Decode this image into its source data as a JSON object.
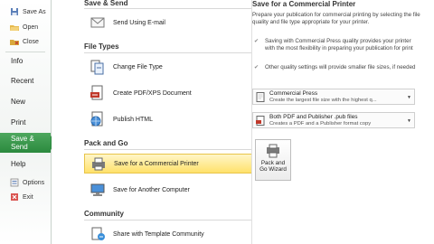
{
  "sidebar": {
    "small_top": [
      {
        "label": "Save As",
        "icon": "save-as-icon"
      },
      {
        "label": "Open",
        "icon": "open-folder-icon"
      },
      {
        "label": "Close",
        "icon": "close-folder-icon"
      }
    ],
    "main": [
      {
        "label": "Info"
      },
      {
        "label": "Recent"
      },
      {
        "label": "New"
      },
      {
        "label": "Print"
      },
      {
        "label": "Save & Send",
        "active": true
      },
      {
        "label": "Help"
      }
    ],
    "small_bottom": [
      {
        "label": "Options",
        "icon": "options-icon"
      },
      {
        "label": "Exit",
        "icon": "exit-icon"
      }
    ]
  },
  "middle": {
    "save_send": {
      "title": "Save & Send",
      "items": [
        {
          "label": "Send Using E-mail"
        }
      ]
    },
    "file_types": {
      "title": "File Types",
      "items": [
        {
          "label": "Change File Type"
        },
        {
          "label": "Create PDF/XPS Document"
        },
        {
          "label": "Publish HTML"
        }
      ]
    },
    "pack_go": {
      "title": "Pack and Go",
      "items": [
        {
          "label": "Save for a Commercial Printer",
          "selected": true
        },
        {
          "label": "Save for Another Computer"
        }
      ]
    },
    "community": {
      "title": "Community",
      "items": [
        {
          "label": "Share with Template Community"
        }
      ]
    }
  },
  "right": {
    "title": "Save for a Commercial Printer",
    "desc": "Prepare your publication for commercial printing by selecting the file quality and file type appropriate for your printer.",
    "bullets": [
      "Saving with Commercial Press quality provides your printer with the most flexibility in preparing your publication for print",
      "Other quality settings will provide smaller file sizes, if needed"
    ],
    "quality_dropdown": {
      "title": "Commercial Press",
      "subtitle": "Create the largest file size with the highest q..."
    },
    "type_dropdown": {
      "title": "Both PDF and Publisher .pub files",
      "subtitle": "Creates a PDF and a Publisher format copy"
    },
    "pack_button": {
      "line1": "Pack and",
      "line2": "Go Wizard"
    }
  },
  "colors": {
    "accent_green": "#2b8a3e",
    "highlight_yellow": "#ffe16b"
  }
}
